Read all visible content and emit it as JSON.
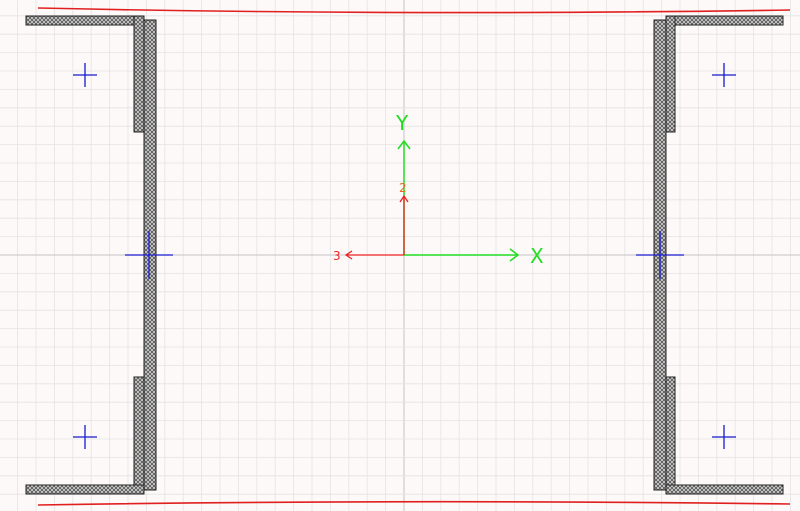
{
  "axes": {
    "x_label": "X",
    "y_label": "Y",
    "axis_2_label": "2",
    "axis_3_label": "3"
  },
  "colors": {
    "background": "#fdf9f8",
    "grid_minor": "#e4e4e4",
    "grid_major": "#c4c4c4",
    "green_axis": "#22dd22",
    "red_axis": "#ee2020",
    "marker_blue": "#1a1ad0",
    "hatch": "#555555",
    "outline": "#222222",
    "edge_line": "#e02020"
  },
  "icons": {
    "marker": "crosshair-plus-icon",
    "hatch": "crosshatch-pattern"
  }
}
